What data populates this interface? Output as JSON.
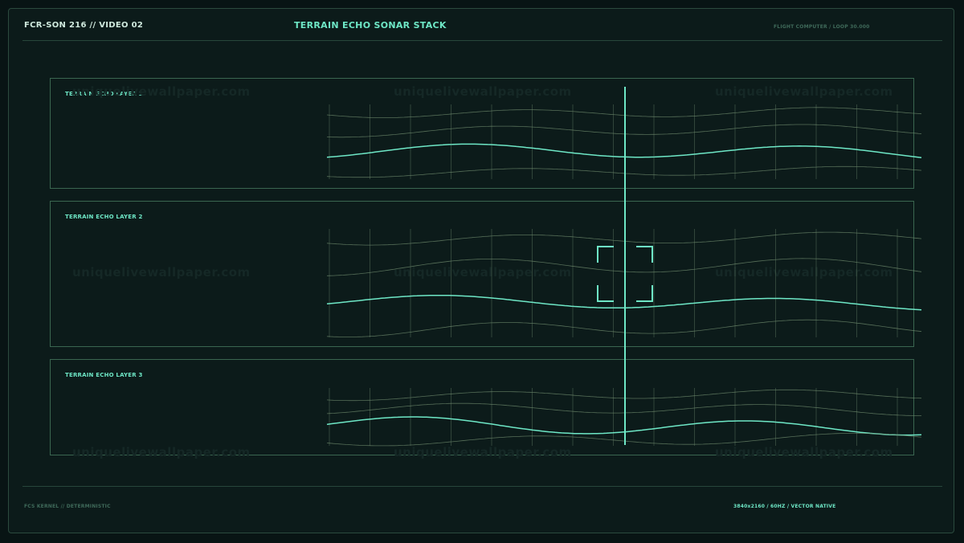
{
  "header": {
    "left": "FCR-SON 216 // VIDEO 02",
    "title": "TERRAIN ECHO SONAR STACK",
    "right": "FLIGHT COMPUTER / LOOP 30.000"
  },
  "footer": {
    "left": "FCS KERNEL // DETERMINISTIC",
    "right": "3840x2160 / 60HZ / VECTOR NATIVE"
  },
  "layers": [
    {
      "label": "TERRAIN ECHO LAYER 1"
    },
    {
      "label": "TERRAIN ECHO LAYER 2"
    },
    {
      "label": "TERRAIN ECHO LAYER 3"
    }
  ],
  "watermark": "uniquelivewallpaper.com",
  "colors": {
    "background": "#081414",
    "panel": "#0c1b1a",
    "accent": "#6ee7c6",
    "grid": "#6f8b6e",
    "border": "#3a6650"
  }
}
